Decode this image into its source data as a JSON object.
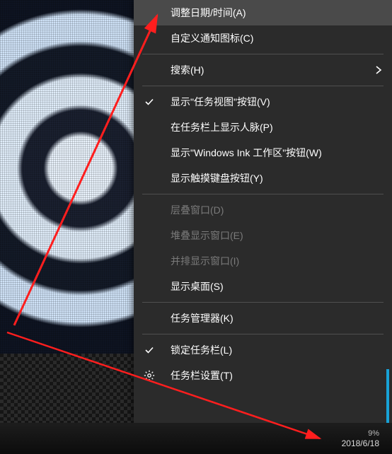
{
  "menu": {
    "items": [
      {
        "label": "调整日期/时间(A)",
        "hover": true
      },
      {
        "label": "自定义通知图标(C)"
      },
      {
        "sep": true
      },
      {
        "label": "搜索(H)",
        "submenu": true
      },
      {
        "sep": true
      },
      {
        "label": "显示\"任务视图\"按钮(V)",
        "checked": true
      },
      {
        "label": "在任务栏上显示人脉(P)"
      },
      {
        "label": "显示\"Windows Ink 工作区\"按钮(W)"
      },
      {
        "label": "显示触摸键盘按钮(Y)"
      },
      {
        "sep": true
      },
      {
        "label": "层叠窗口(D)",
        "disabled": true
      },
      {
        "label": "堆叠显示窗口(E)",
        "disabled": true
      },
      {
        "label": "并排显示窗口(I)",
        "disabled": true
      },
      {
        "label": "显示桌面(S)"
      },
      {
        "sep": true
      },
      {
        "label": "任务管理器(K)"
      },
      {
        "sep": true
      },
      {
        "label": "锁定任务栏(L)",
        "checked": true
      },
      {
        "label": "任务栏设置(T)",
        "gear": true
      }
    ]
  },
  "taskbar": {
    "trayTop": "9%",
    "date": "2018/6/18"
  },
  "annotation": {
    "color": "#ff1e1e"
  }
}
